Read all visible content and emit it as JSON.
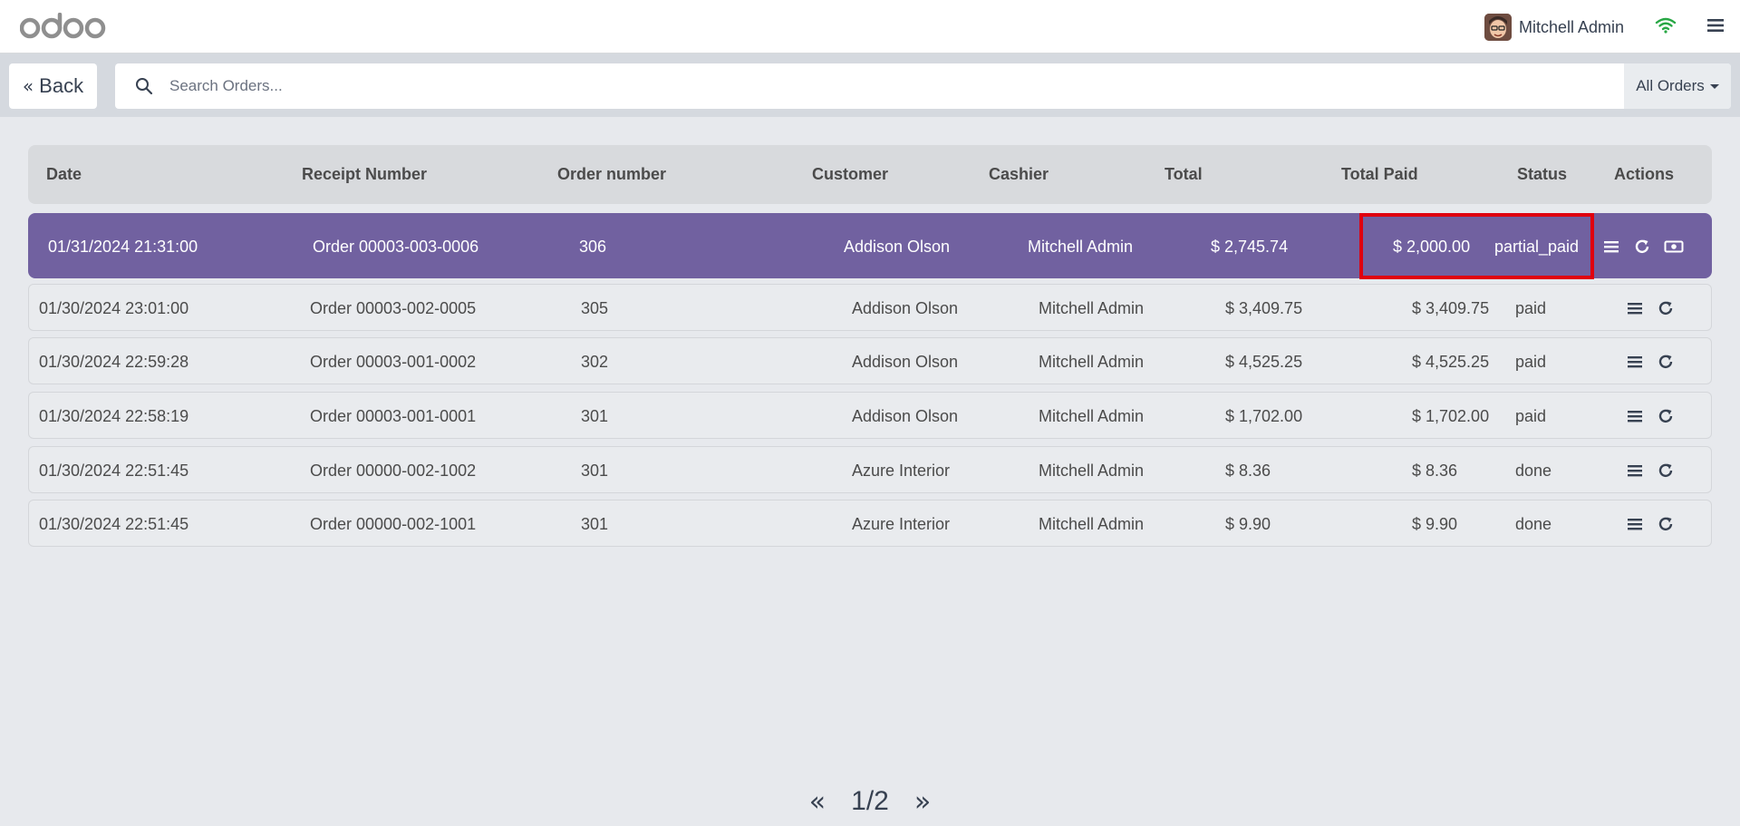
{
  "app": {
    "logo_text": "odoo"
  },
  "navbar": {
    "user_name": "Mitchell Admin",
    "wifi_icon": "wifi-icon",
    "menu_icon": "hamburger-icon"
  },
  "controlbar": {
    "back_label": "Back",
    "search_placeholder": "Search Orders...",
    "filter_label": "All Orders"
  },
  "table": {
    "headers": [
      "Date",
      "Receipt Number",
      "Order number",
      "Customer",
      "Cashier",
      "Total",
      "Total Paid",
      "Status",
      "Actions"
    ],
    "rows": [
      {
        "date": "01/31/2024 21:31:00",
        "receipt": "Order 00003-003-0006",
        "order_no": "306",
        "customer": "Addison Olson",
        "cashier": "Mitchell Admin",
        "total": "$ 2,745.74",
        "total_paid": "$ 2,000.00",
        "status": "partial_paid",
        "selected": true
      },
      {
        "date": "01/30/2024 23:01:00",
        "receipt": "Order 00003-002-0005",
        "order_no": "305",
        "customer": "Addison Olson",
        "cashier": "Mitchell Admin",
        "total": "$ 3,409.75",
        "total_paid": "$ 3,409.75",
        "status": "paid",
        "selected": false
      },
      {
        "date": "01/30/2024 22:59:28",
        "receipt": "Order 00003-001-0002",
        "order_no": "302",
        "customer": "Addison Olson",
        "cashier": "Mitchell Admin",
        "total": "$ 4,525.25",
        "total_paid": "$ 4,525.25",
        "status": "paid",
        "selected": false
      },
      {
        "date": "01/30/2024 22:58:19",
        "receipt": "Order 00003-001-0001",
        "order_no": "301",
        "customer": "Addison Olson",
        "cashier": "Mitchell Admin",
        "total": "$ 1,702.00",
        "total_paid": "$ 1,702.00",
        "status": "paid",
        "selected": false
      },
      {
        "date": "01/30/2024 22:51:45",
        "receipt": "Order 00000-002-1002",
        "order_no": "301",
        "customer": "Azure Interior",
        "cashier": "Mitchell Admin",
        "total": "$ 8.36",
        "total_paid": "$ 8.36",
        "status": "done",
        "selected": false
      },
      {
        "date": "01/30/2024 22:51:45",
        "receipt": "Order 00000-002-1001",
        "order_no": "301",
        "customer": "Azure Interior",
        "cashier": "Mitchell Admin",
        "total": "$ 9.90",
        "total_paid": "$ 9.90",
        "status": "done",
        "selected": false
      }
    ]
  },
  "pager": {
    "label": "1/2",
    "prev": "«",
    "next": "»"
  },
  "colors": {
    "accent": "#7161a0",
    "highlight": "#e0000f",
    "wifi": "#28a745",
    "logo": "#714b67"
  }
}
